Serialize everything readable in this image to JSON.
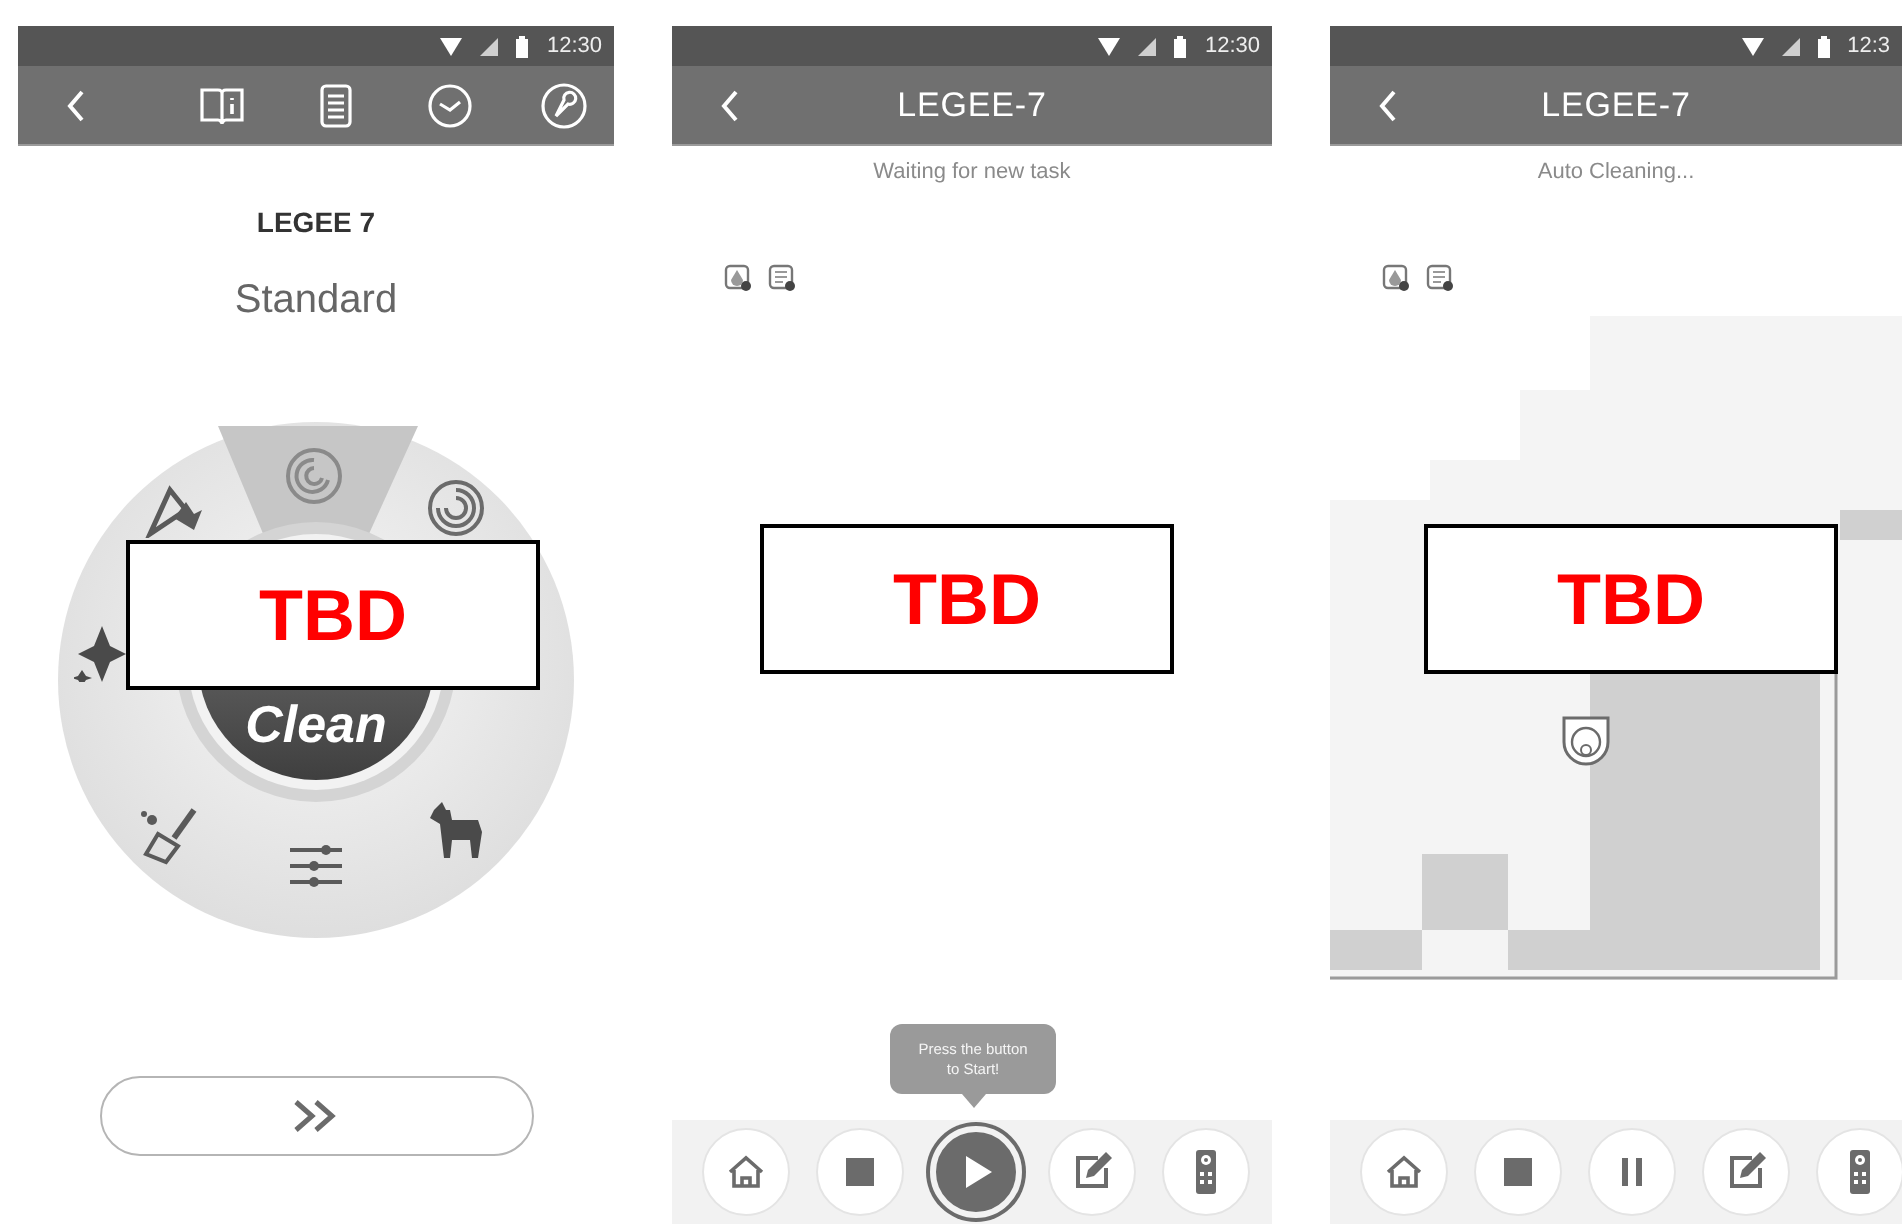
{
  "screens": [
    {
      "kind": "dial",
      "status_bar": {
        "time": "12:30"
      },
      "toolbar_icons": [
        {
          "kind": "manual"
        },
        {
          "kind": "log"
        },
        {
          "kind": "schedule"
        },
        {
          "kind": "settings"
        }
      ],
      "device_name": "LEGEE 7",
      "mode": "Standard",
      "dial": {
        "center_label": "Clean"
      },
      "overlay": "TBD"
    },
    {
      "kind": "control",
      "status_bar": {
        "time": "12:30"
      },
      "title": "LEGEE-7",
      "status": "Waiting for new task",
      "tooltip": "Press the button to Start!",
      "controls": [
        {
          "kind": "home"
        },
        {
          "kind": "stop"
        },
        {
          "kind": "play"
        },
        {
          "kind": "edit"
        },
        {
          "kind": "remote"
        }
      ],
      "overlay": "TBD"
    },
    {
      "kind": "control",
      "status_bar": {
        "time": "12:3"
      },
      "title": "LEGEE-7",
      "status": "Auto Cleaning...",
      "map_shown": true,
      "controls": [
        {
          "kind": "home"
        },
        {
          "kind": "stop"
        },
        {
          "kind": "pause"
        },
        {
          "kind": "edit"
        },
        {
          "kind": "remote"
        }
      ],
      "overlay": "TBD"
    }
  ]
}
